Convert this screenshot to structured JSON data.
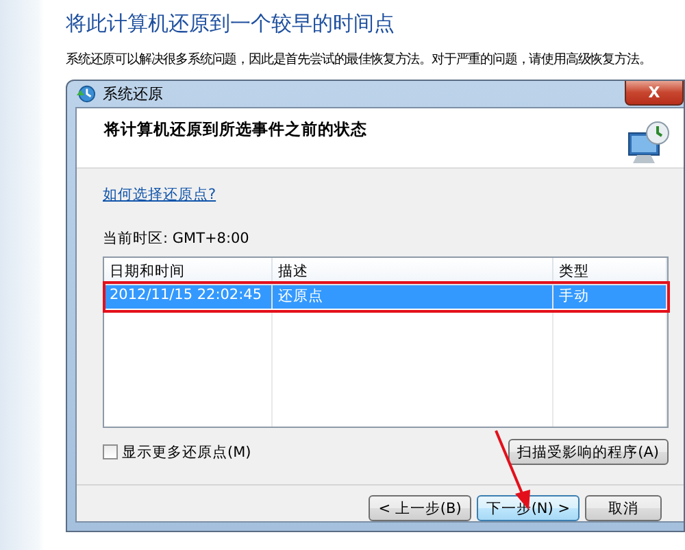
{
  "page": {
    "heading": "将此计算机还原到一个较早的时间点",
    "description": "系统还原可以解决很多系统问题，因此是首先尝试的最佳恢复方法。对于严重的问题，请使用高级恢复方法。"
  },
  "dialog": {
    "title": "系统还原",
    "close": "X",
    "header": "将计算机还原到所选事件之前的状态",
    "link": "如何选择还原点?",
    "timezone": "当前时区: GMT+8:00",
    "table": {
      "columns": [
        "日期和时间",
        "描述",
        "类型"
      ],
      "rows": [
        {
          "cells": [
            "2012/11/15 22:02:45",
            "还原点",
            "手动"
          ],
          "selected": true,
          "highlighted": true
        }
      ]
    },
    "show_more": {
      "label": "显示更多还原点(M)",
      "checked": false
    },
    "scan_button": "扫描受影响的程序(A)",
    "buttons": [
      {
        "label": "< 上一步(B)",
        "pointed": false
      },
      {
        "label": "下一步(N) >",
        "pointed": true
      },
      {
        "label": "取消",
        "pointed": false
      }
    ]
  }
}
